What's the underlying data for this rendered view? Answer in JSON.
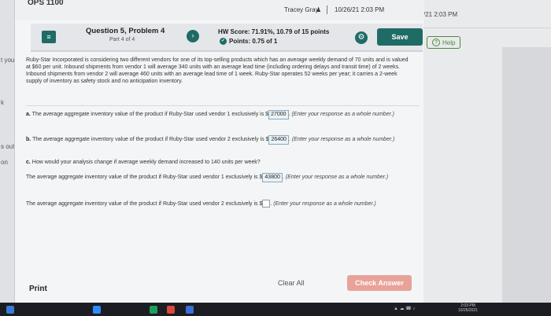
{
  "topbar": {
    "app_title": "OPS 1100",
    "user_name": "Tracey Gray",
    "user_icon": "person-icon",
    "datetime": "10/26/21 2:03 PM"
  },
  "side_window": {
    "time": "/21 2:03 PM",
    "help_label": "Help"
  },
  "left_strip": {
    "items": [
      "t you",
      "k",
      "s out",
      "on"
    ]
  },
  "question_bar": {
    "menu_icon": "list-menu-icon",
    "title": "Question 5, Problem 4",
    "part": "Part 4 of 4",
    "hw_score": "HW Score: 71.91%, 10.79 of 15 points",
    "points": "Points: 0.75 of 1",
    "save_label": "Save"
  },
  "problem_text": "Ruby-Star Incorporated is considering two different vendors for one of its top-selling products which has an average weekly demand of 70 units and is valued at $60 per unit. Inbound shipments from vendor 1 will average 340 units with an average lead time (including ordering delays and transit time) of 2 weeks. Inbound shipments from vendor 2 will average 460 units with an average lead time of 1 week. Ruby-Star operates 52 weeks per year; it carries a 2-week supply of inventory as safety stock and no anticipation inventory.",
  "parts": {
    "a_label": "a.",
    "a_text": "The average aggregate inventory value of the product if Ruby-Star used vendor 1 exclusively is $",
    "a_value": "27000",
    "a_hint": "(Enter your response as a whole number.)",
    "b_label": "b.",
    "b_text": "The average aggregate inventory value of the product if Ruby-Star used vendor 2 exclusively is $",
    "b_value": "26400",
    "b_hint": "(Enter your response as a whole number.)",
    "c_label": "c.",
    "c_text": "How would your analysis change if average weekly demand increased to 140 units per week?",
    "c1_text": "The average aggregate inventory value of the product if Ruby-Star used vendor 1 exclusively is $",
    "c1_value": "43800",
    "c1_hint": "(Enter your response as a whole number.)",
    "c2_text": "The average aggregate inventory value of the product if Ruby-Star used vendor 2 exclusively is $",
    "c2_value": "",
    "c2_hint": "(Enter your response as a whole number.)"
  },
  "footer": {
    "print_label": "Print",
    "clear_all_label": "Clear All",
    "check_answer_label": "Check Answer"
  },
  "taskbar": {
    "time": "2:03 PM",
    "date": "10/26/2021"
  },
  "colors": {
    "accent": "#1f6b66",
    "check_button": "#e8a29a"
  }
}
